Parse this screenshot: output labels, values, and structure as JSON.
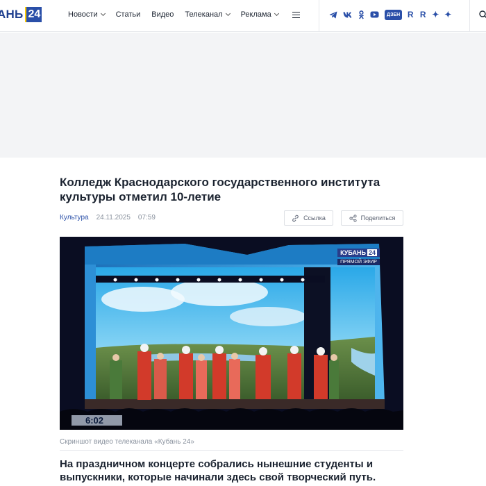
{
  "header": {
    "logo_text": "АНЬ",
    "logo_num": "24",
    "nav": [
      {
        "label": "Новости",
        "dropdown": true
      },
      {
        "label": "Статьи",
        "dropdown": false
      },
      {
        "label": "Видео",
        "dropdown": false
      },
      {
        "label": "Телеканал",
        "dropdown": true
      },
      {
        "label": "Реклама",
        "dropdown": true
      }
    ],
    "socials": {
      "telegram": "telegram-icon",
      "vk": "vk-icon",
      "ok": "odnoklassniki-icon",
      "youtube": "youtube-icon",
      "dzen_label": "ДЗЕН",
      "rutube_1": "R",
      "rutube_2": "R",
      "star_1": "✦",
      "star_2": "✦"
    },
    "accent_color": "#2a4fa8"
  },
  "article": {
    "title": "Колледж Краснодарского государственного института культуры отметил 10-летие",
    "category": "Культура",
    "date": "24.11.2025",
    "time": "07:59",
    "link_button": "Ссылка",
    "share_button": "Поделиться",
    "video": {
      "channel": "КУБАНЬ",
      "channel_num": "24",
      "live_label": "ПРЯМОЙ ЭФИР",
      "timecode": "6:02"
    },
    "caption": "Скриншот видео телеканала «Кубань 24»",
    "lead": "На праздничном концерте собрались нынешние студенты и выпускники, которые начинали здесь свой творческий путь."
  }
}
